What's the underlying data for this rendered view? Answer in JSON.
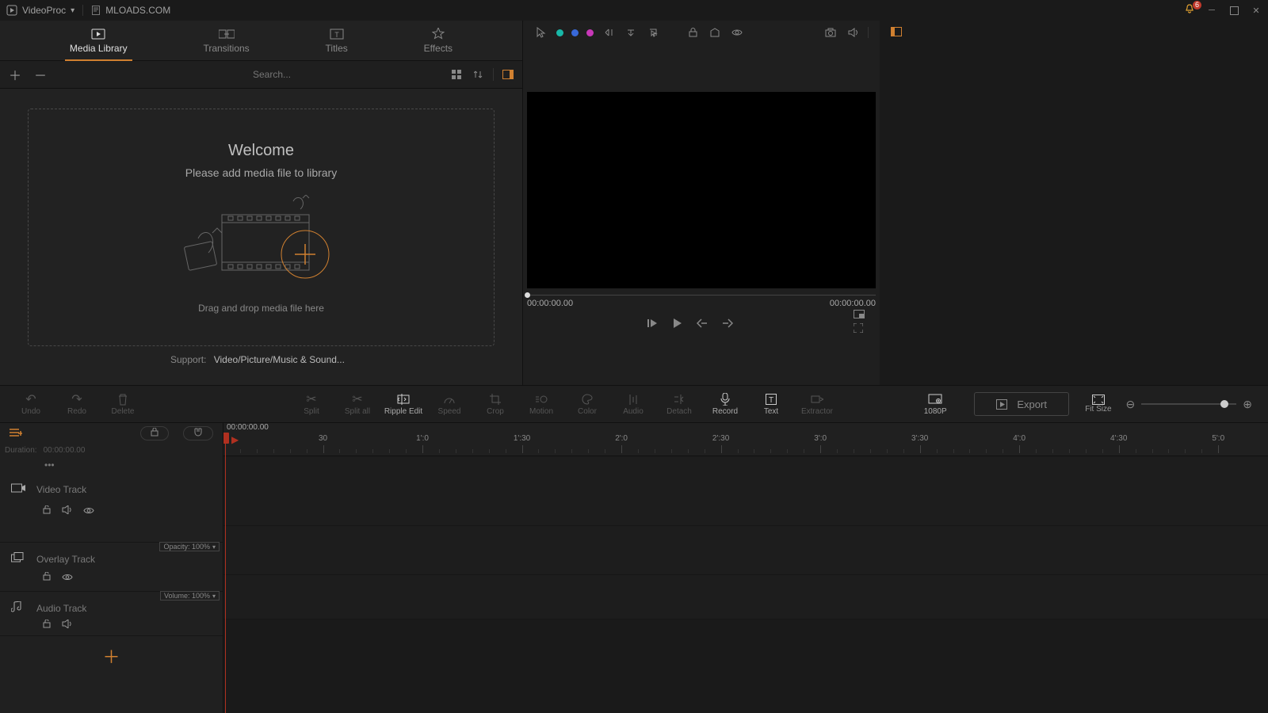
{
  "titlebar": {
    "app_name": "VideoProc",
    "secondary": "MLOADS.COM",
    "notif_count": "6"
  },
  "media_tabs": {
    "library": "Media Library",
    "transitions": "Transitions",
    "titles": "Titles",
    "effects": "Effects"
  },
  "media_toolbar": {
    "search_placeholder": "Search..."
  },
  "drop_zone": {
    "welcome": "Welcome",
    "subtitle": "Please add media file to library",
    "hint": "Drag and drop media file here"
  },
  "support": {
    "label": "Support:",
    "value": "Video/Picture/Music & Sound..."
  },
  "preview": {
    "time_left": "00:00:00.00",
    "time_right": "00:00:00.00"
  },
  "tools": {
    "undo": "Undo",
    "redo": "Redo",
    "delete": "Delete",
    "split": "Split",
    "split_all": "Split all",
    "ripple": "Ripple Edit",
    "speed": "Speed",
    "crop": "Crop",
    "motion": "Motion",
    "color": "Color",
    "audio": "Audio",
    "detach": "Detach",
    "record": "Record",
    "text": "Text",
    "extractor": "Extractor",
    "res": "1080P",
    "export": "Export",
    "fit": "Fit Size"
  },
  "timeline": {
    "duration_label": "Duration:",
    "duration_val": "00:00:00.00",
    "now": "00:00:00.00",
    "video_track": "Video Track",
    "overlay_track": "Overlay Track",
    "audio_track": "Audio Track",
    "opacity": "Opacity: 100%",
    "volume": "Volume: 100%",
    "ticks": [
      "30",
      "1':0",
      "1':30",
      "2':0",
      "2':30",
      "3':0",
      "3':30",
      "4':0",
      "4':30",
      "5':0"
    ]
  }
}
